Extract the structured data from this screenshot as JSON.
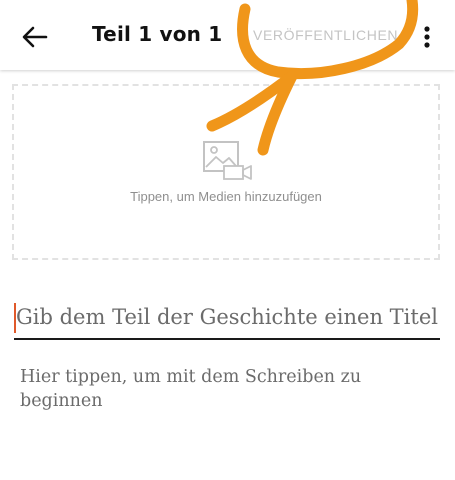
{
  "header": {
    "title": "Teil 1 von 1",
    "publish_label": "VERÖFFENTLICHEN",
    "back_icon": "arrow-left-icon",
    "more_icon": "more-vertical-icon"
  },
  "media": {
    "label": "Tippen, um Medien hinzuzufügen",
    "icon": "image-video-icon"
  },
  "editor": {
    "title_placeholder": "Gib dem Teil der Geschichte einen Titel",
    "body_placeholder": "Hier tippen, um mit dem Schreiben zu beginnen"
  },
  "colors": {
    "accent_caret": "#e0592a",
    "annotation": "#f0961a",
    "publish_disabled": "#c4c4c4"
  }
}
